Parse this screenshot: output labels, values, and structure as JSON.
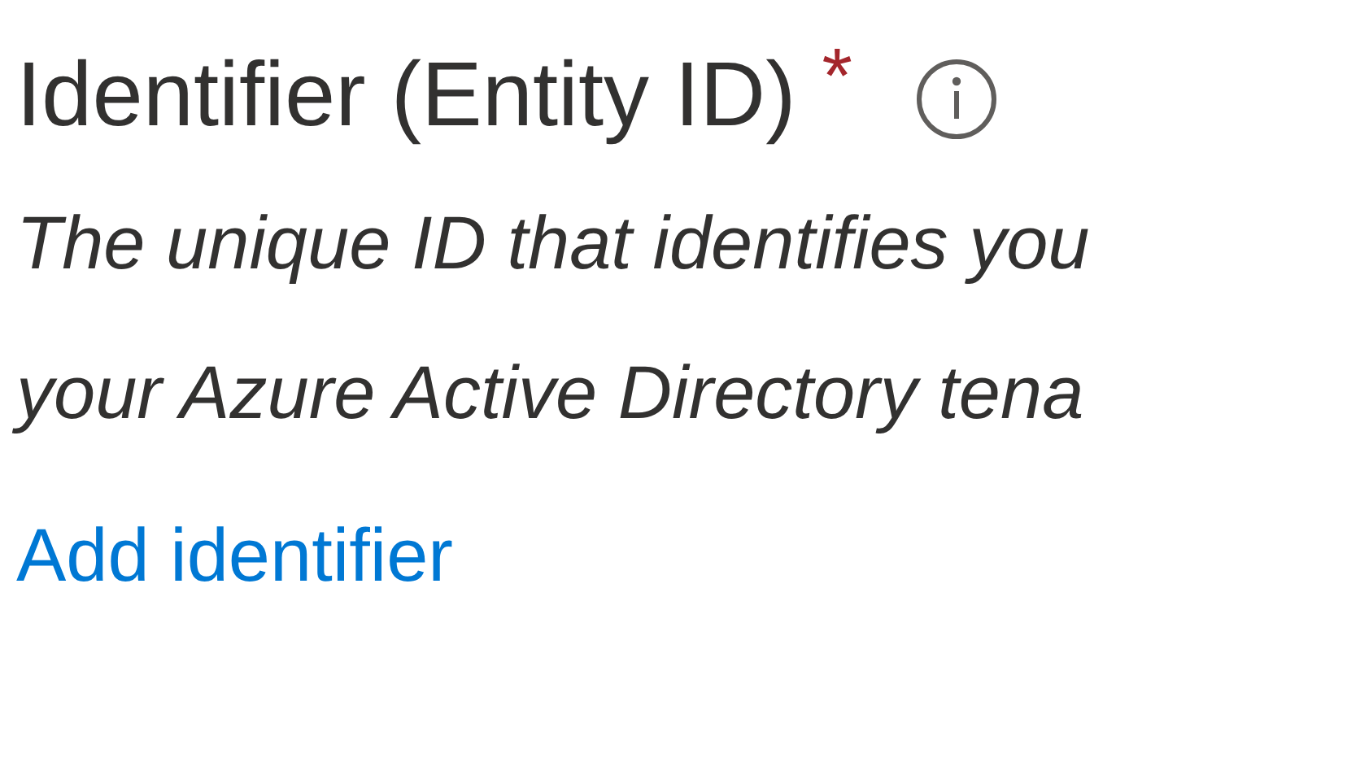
{
  "field": {
    "label": "Identifier (Entity ID)",
    "required": true,
    "required_mark": "*"
  },
  "description": [
    "The unique ID that identifies you",
    "your Azure Active Directory tena"
  ],
  "link": "Add identifier"
}
